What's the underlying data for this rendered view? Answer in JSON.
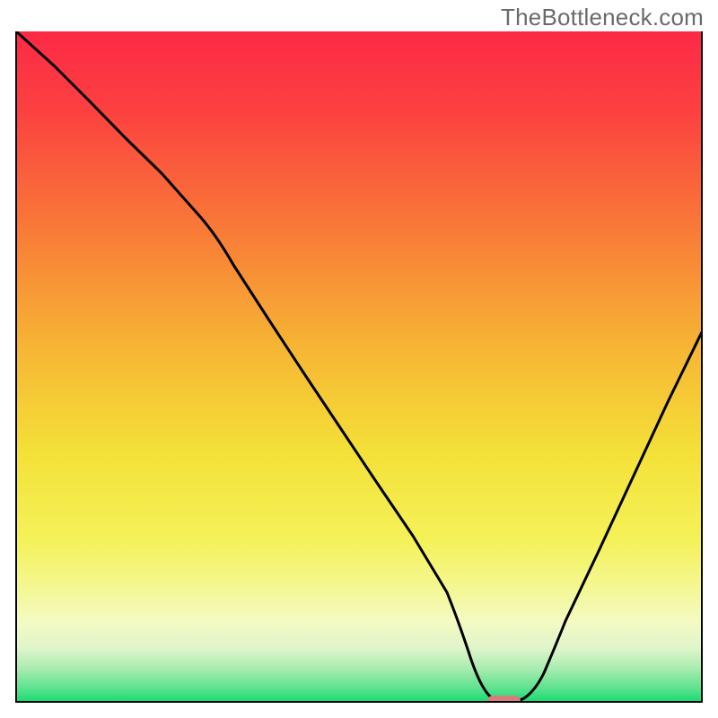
{
  "watermark": "TheBottleneck.com",
  "colors": {
    "gradient_top": "#fd2946",
    "gradient_mid1": "#f7a031",
    "gradient_mid2": "#f4ec3b",
    "gradient_mid3": "#f3f8a0",
    "gradient_bottom": "#18db72",
    "curve": "#000000",
    "marker": "#d77c7a",
    "frame": "#000000"
  },
  "chart_data": {
    "type": "line",
    "title": "",
    "xlabel": "",
    "ylabel": "",
    "xlim": [
      0,
      100
    ],
    "ylim": [
      0,
      100
    ],
    "legend": "none",
    "grid": false,
    "annotations": [
      "TheBottleneck.com"
    ],
    "x": [
      0,
      5,
      10,
      15,
      20,
      25,
      30,
      35,
      40,
      45,
      50,
      55,
      60,
      63,
      66,
      69,
      72,
      76,
      80,
      85,
      90,
      95,
      100
    ],
    "values": [
      100,
      95,
      89,
      84,
      79,
      73,
      65,
      57,
      49,
      41,
      33,
      25,
      16,
      7,
      1,
      0,
      0,
      1,
      8,
      19,
      30,
      41,
      52
    ],
    "marker_point": {
      "x": 70,
      "y": 0
    }
  }
}
